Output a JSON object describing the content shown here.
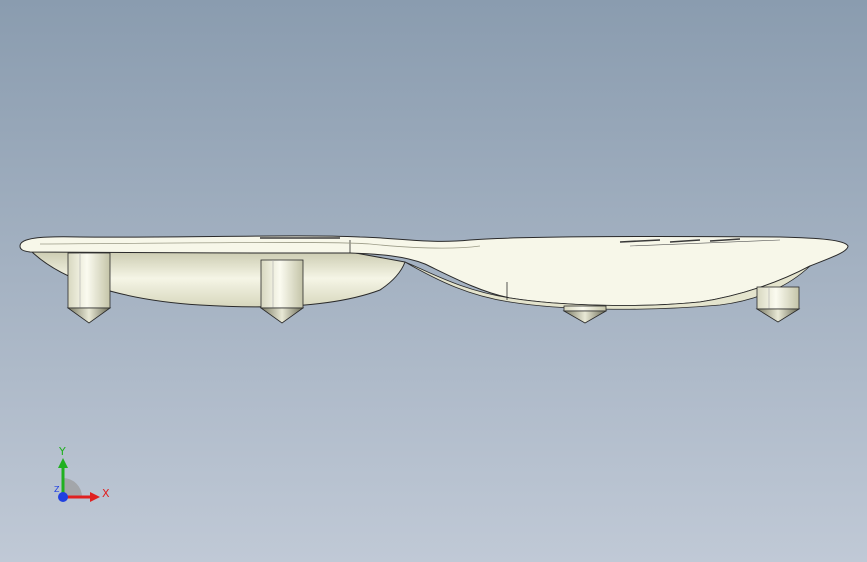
{
  "viewport": {
    "background_top": "#8a9caf",
    "background_bottom": "#c0c9d6",
    "model_fill": "#f7f7e9",
    "model_shade": "#ddddc4",
    "edge_color": "#2a2a2a"
  },
  "triad": {
    "x_label": "X",
    "y_label": "Y",
    "z_label": "Z",
    "x_color": "#e02020",
    "y_color": "#20b020",
    "z_color": "#2040e0"
  }
}
